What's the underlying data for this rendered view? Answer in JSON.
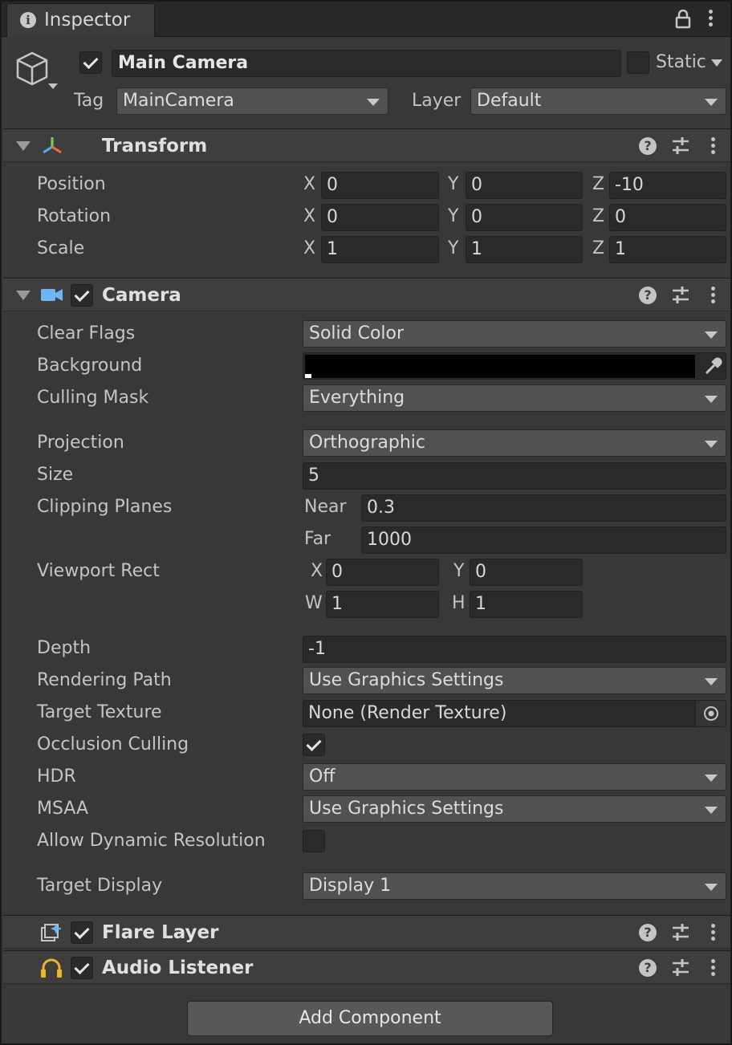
{
  "tab": {
    "title": "Inspector"
  },
  "header": {
    "active": true,
    "name": "Main Camera",
    "static_label": "Static",
    "static": false,
    "tag_label": "Tag",
    "tag_value": "MainCamera",
    "layer_label": "Layer",
    "layer_value": "Default"
  },
  "transform": {
    "title": "Transform",
    "rows": [
      {
        "label": "Position",
        "x": "0",
        "y": "0",
        "z": "-10"
      },
      {
        "label": "Rotation",
        "x": "0",
        "y": "0",
        "z": "0"
      },
      {
        "label": "Scale",
        "x": "1",
        "y": "1",
        "z": "1"
      }
    ],
    "axis": {
      "x": "X",
      "y": "Y",
      "z": "Z"
    }
  },
  "camera": {
    "title": "Camera",
    "enabled": true,
    "clear_flags": {
      "label": "Clear Flags",
      "value": "Solid Color"
    },
    "background": {
      "label": "Background",
      "color": "#000000"
    },
    "culling_mask": {
      "label": "Culling Mask",
      "value": "Everything"
    },
    "projection": {
      "label": "Projection",
      "value": "Orthographic"
    },
    "size": {
      "label": "Size",
      "value": "5"
    },
    "clipping": {
      "label": "Clipping Planes",
      "near_label": "Near",
      "near": "0.3",
      "far_label": "Far",
      "far": "1000"
    },
    "viewport": {
      "label": "Viewport Rect",
      "x_label": "X",
      "x": "0",
      "y_label": "Y",
      "y": "0",
      "w_label": "W",
      "w": "1",
      "h_label": "H",
      "h": "1"
    },
    "depth": {
      "label": "Depth",
      "value": "-1"
    },
    "rendering_path": {
      "label": "Rendering Path",
      "value": "Use Graphics Settings"
    },
    "target_texture": {
      "label": "Target Texture",
      "value": "None (Render Texture)"
    },
    "occlusion": {
      "label": "Occlusion Culling",
      "checked": true
    },
    "hdr": {
      "label": "HDR",
      "value": "Off"
    },
    "msaa": {
      "label": "MSAA",
      "value": "Use Graphics Settings"
    },
    "dynamic_res": {
      "label": "Allow Dynamic Resolution",
      "checked": false
    },
    "target_display": {
      "label": "Target Display",
      "value": "Display 1"
    }
  },
  "flare_layer": {
    "title": "Flare Layer",
    "enabled": true
  },
  "audio_listener": {
    "title": "Audio Listener",
    "enabled": true
  },
  "add_component": {
    "label": "Add Component"
  },
  "colors": {
    "accent_blue": "#6fb4f5",
    "audio_yellow": "#f0b429"
  }
}
